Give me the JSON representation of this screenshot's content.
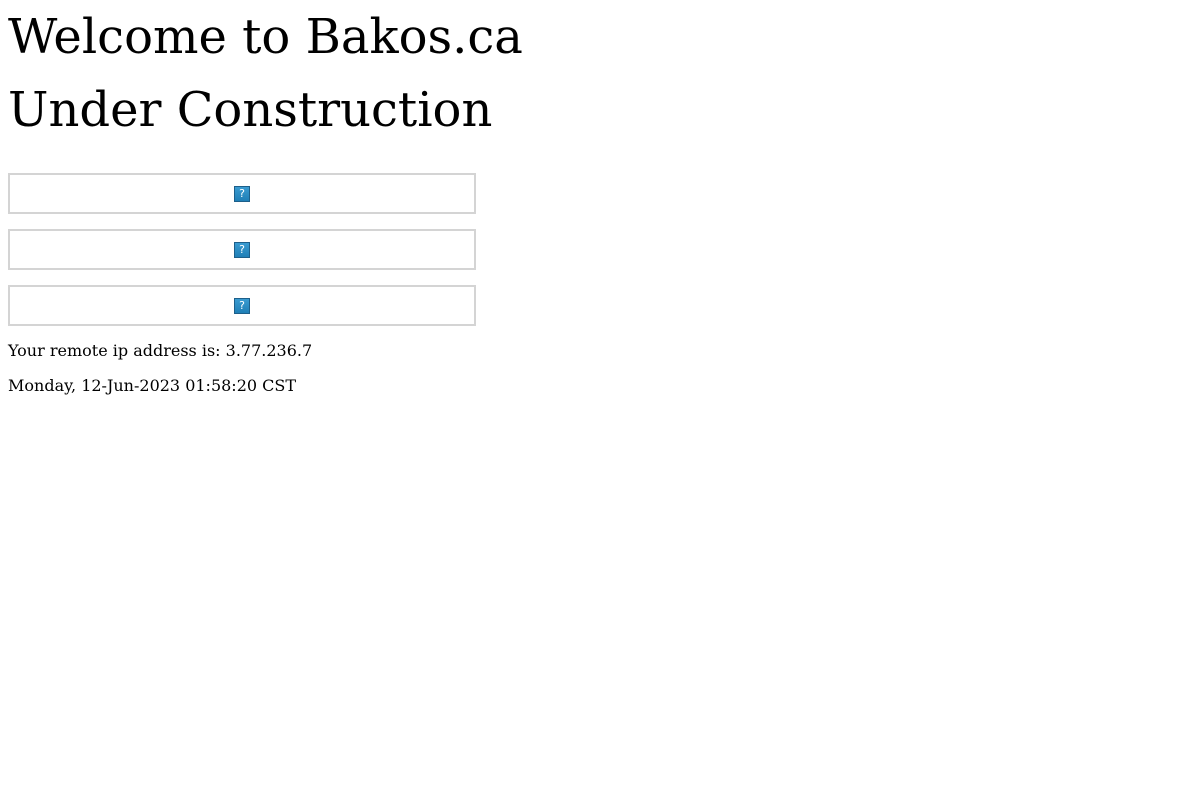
{
  "page": {
    "heading": "Welcome to Bakos.ca",
    "subheading": "Under Construction"
  },
  "images": [
    {
      "icon": "broken-image-icon",
      "glyph": "?"
    },
    {
      "icon": "broken-image-icon",
      "glyph": "?"
    },
    {
      "icon": "broken-image-icon",
      "glyph": "?"
    }
  ],
  "info": {
    "ip_line": "Your remote ip address is: 3.77.236.7",
    "date_line": "Monday, 12-Jun-2023 01:58:20 CST"
  },
  "colors": {
    "icon_fill": "#1f7fb6",
    "box_border": "#d4d4d4"
  }
}
